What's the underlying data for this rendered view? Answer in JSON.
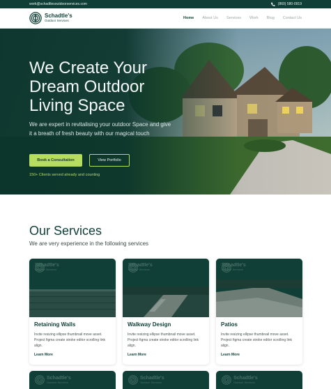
{
  "topbar": {
    "email": "work@schadtlesoutdoorservices.com",
    "phone": "(860) 580-0919",
    "phone_icon": "phone-icon"
  },
  "brand": {
    "name": "Schadtle's",
    "tagline": "Outdoor Services",
    "logo_icon": "concentric-circle-logo-icon"
  },
  "nav": {
    "items": [
      {
        "label": "Home",
        "active": true
      },
      {
        "label": "About Us",
        "active": false
      },
      {
        "label": "Services",
        "active": false
      },
      {
        "label": "Work",
        "active": false
      },
      {
        "label": "Blog",
        "active": false
      },
      {
        "label": "Contact Us",
        "active": false
      }
    ]
  },
  "hero": {
    "headline": "We Create Your Dream Outdoor Living Space",
    "subheadline": "We are expert in revitalising your outdoor Space and give it a breath of fresh beauty with our magical touch",
    "primary_cta": "Book a Consultation",
    "secondary_cta": "View Portfolio",
    "social_proof": "150+ Clients served already and counting"
  },
  "services": {
    "title": "Our Services",
    "subtitle": "We are very experience in the following services",
    "cards": [
      {
        "title": "Retaining Walls",
        "description": "Invite resizing ellipse thumbnail move asset. Project figma create stroke editor scrolling link align.",
        "link": "Learn More"
      },
      {
        "title": "Walkway Design",
        "description": "Invite resizing ellipse thumbnail move asset. Project figma create stroke editor scrolling link align.",
        "link": "Learn More"
      },
      {
        "title": "Patios",
        "description": "Invite resizing ellipse thumbnail move asset. Project figma create stroke editor scrolling link align.",
        "link": "Learn More"
      }
    ]
  },
  "colors": {
    "brand_dark_green": "#0f3f36",
    "accent_lime": "#b7dd5e",
    "background": "#ffffff"
  }
}
